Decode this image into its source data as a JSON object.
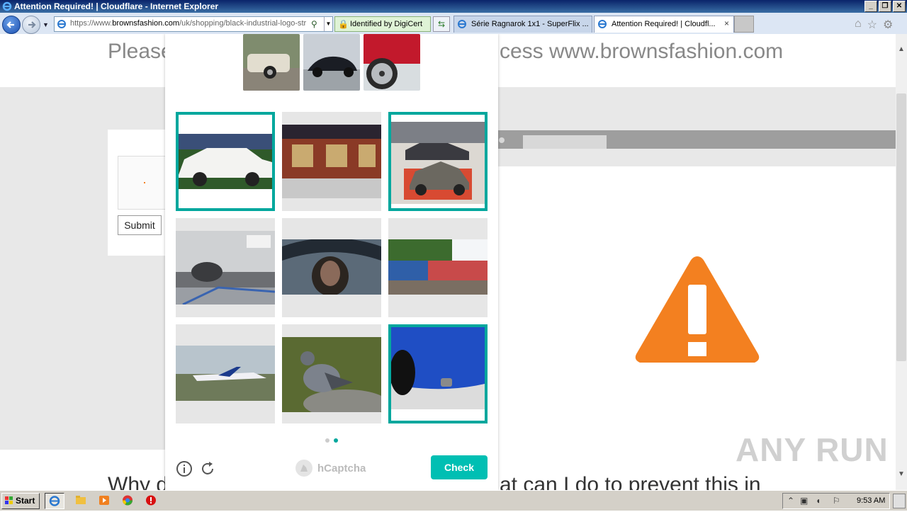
{
  "window": {
    "title": "Attention Required! | Cloudflare - Internet Explorer"
  },
  "address": {
    "url_scheme": "https://www.",
    "url_host": "brownsfashion.com",
    "url_path": "/uk/shopping/black-industrial-logo-str",
    "cert": "Identified by DigiCert"
  },
  "tabs": [
    {
      "label": "Série Ragnarok 1x1 - SuperFlix ...",
      "active": false
    },
    {
      "label": "Attention Required! | Cloudfl...",
      "active": true,
      "close": "×"
    }
  ],
  "page": {
    "please_left": "Please",
    "please_right": "cess www.brownsfashion.com",
    "submit": "Submit",
    "why_left": "Why d",
    "why_right": "at can I do to prevent this in",
    "watermark": "ANY RUN"
  },
  "captcha": {
    "selected": [
      true,
      false,
      true,
      false,
      false,
      false,
      false,
      false,
      true
    ],
    "images": [
      "white sedan car",
      "train interior",
      "vintage car in showroom",
      "car exhaust pipe",
      "person under umbrella",
      "locomotives",
      "airplane on runway",
      "pigeon on rock",
      "blue car rear bumper"
    ],
    "logo": "hCaptcha",
    "check": "Check",
    "page_dots": [
      false,
      true
    ]
  },
  "taskbar": {
    "start": "Start",
    "time": "9:53 AM"
  },
  "icons": [
    "ie-icon",
    "back-icon",
    "forward-icon",
    "search-icon",
    "lock-icon",
    "refresh-icon",
    "home-icon",
    "star-icon",
    "gear-icon",
    "info-icon",
    "reload-icon",
    "warning-icon"
  ],
  "colors": {
    "accent": "#00bfb3",
    "selected_border": "#00a79d",
    "warning": "#f38020"
  }
}
